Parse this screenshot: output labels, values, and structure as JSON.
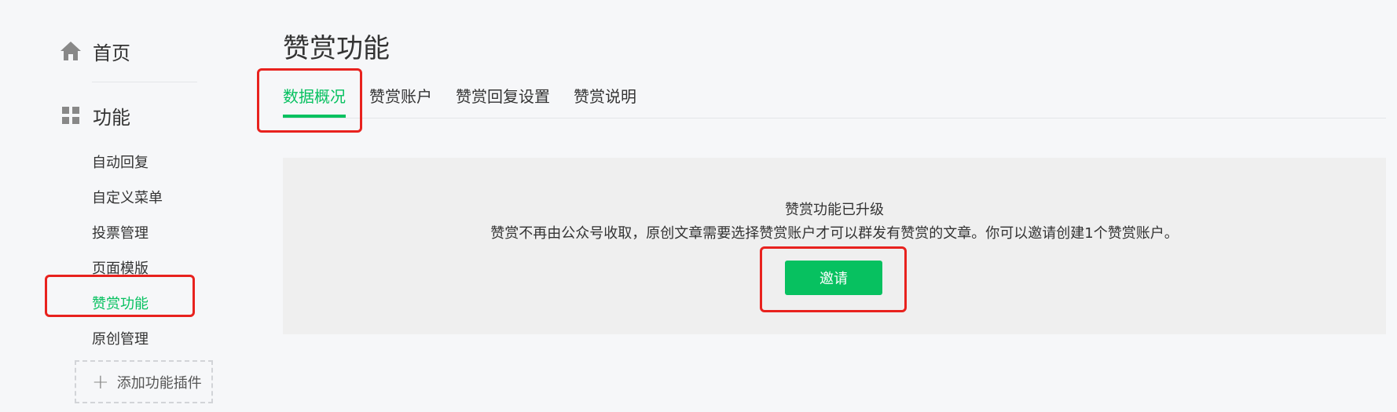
{
  "sidebar": {
    "home_label": "首页",
    "home_icon": "home-icon",
    "feature_label": "功能",
    "feature_icon": "grid-icon",
    "items": [
      {
        "label": "自动回复"
      },
      {
        "label": "自定义菜单"
      },
      {
        "label": "投票管理"
      },
      {
        "label": "页面模版"
      },
      {
        "label": "赞赏功能",
        "active": true
      },
      {
        "label": "原创管理"
      }
    ],
    "add_plugin_label": "添加功能插件",
    "add_plugin_icon": "plus-icon"
  },
  "main": {
    "title": "赞赏功能",
    "tabs": [
      {
        "label": "数据概况",
        "active": true
      },
      {
        "label": "赞赏账户"
      },
      {
        "label": "赞赏回复设置"
      },
      {
        "label": "赞赏说明"
      }
    ],
    "notice": {
      "title": "赞赏功能已升级",
      "description": "赞赏不再由公众号收取，原创文章需要选择赞赏账户才可以群发有赞赏的文章。你可以邀请创建1个赞赏账户。",
      "button_label": "邀请"
    }
  },
  "colors": {
    "accent": "#07c160",
    "highlight": "#e8221e",
    "background": "#f6f7f9",
    "panel": "#efefef"
  }
}
